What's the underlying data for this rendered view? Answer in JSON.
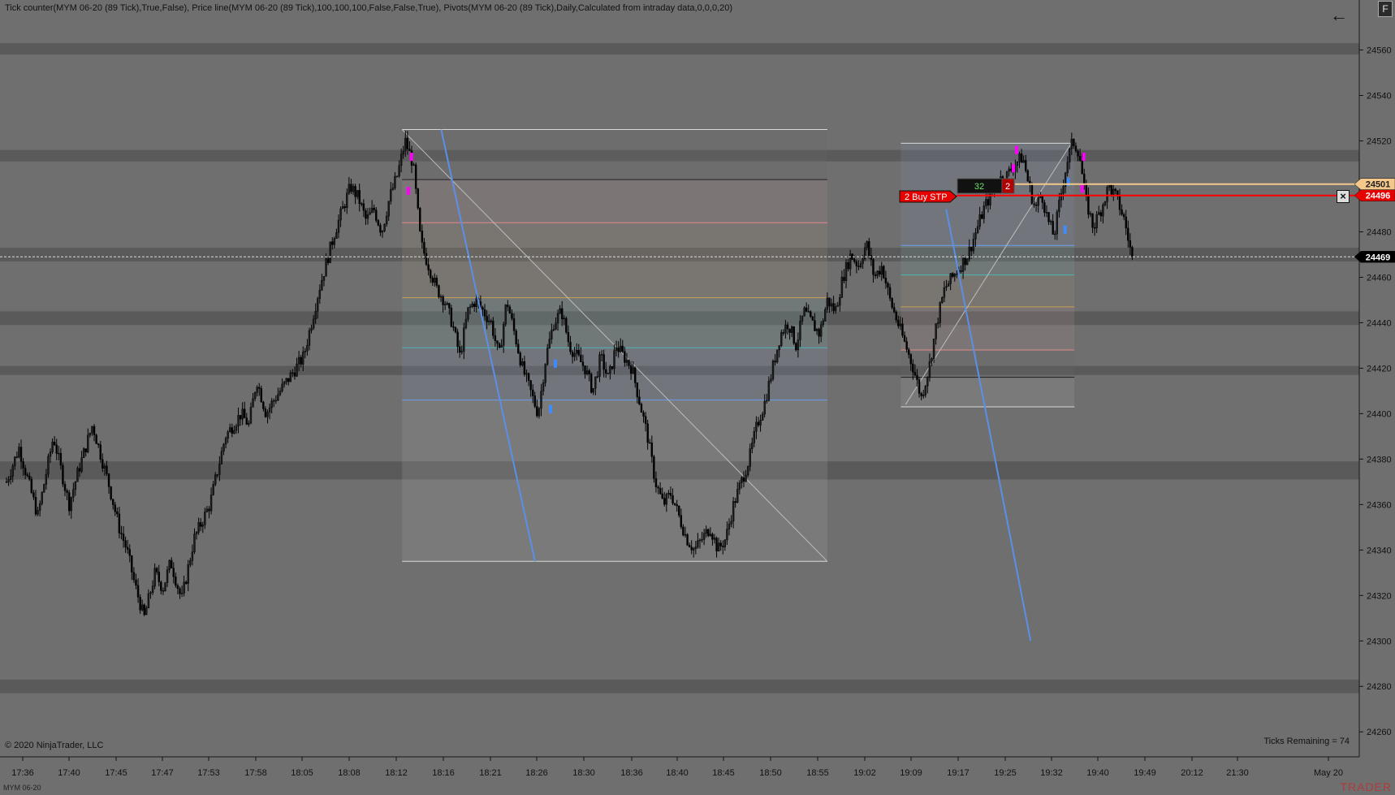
{
  "header": {
    "indicators_caption": "Tick counter(MYM 06-20 (89 Tick),True,False), Price line(MYM 06-20 (89 Tick),100,100,100,False,False,True), Pivots(MYM 06-20 (89 Tick),Daily,Calculated from intraday data,0,0,0,20)",
    "back_icon": "arrow-left-icon",
    "f_button_label": "F"
  },
  "footer": {
    "copyright": "© 2020 NinjaTrader, LLC",
    "ticks_remaining": "Ticks Remaining = 74",
    "instrument": "MYM 06-20",
    "brand": "TRADER"
  },
  "order": {
    "label": "2  Buy STP",
    "pnl_value": "32",
    "quantity": "2",
    "price": "24496",
    "close_icon": "close-x-icon"
  },
  "price_markers": {
    "ask": "24501",
    "last": "24469"
  },
  "colors": {
    "background": "#6f6f6f",
    "band": "#5a5a5a",
    "order_line": "#ff0000",
    "ask_line": "#f4c78a",
    "last_line": "#dddddd",
    "trend_line": "#5b8fe8",
    "marker_magenta": "#ff00ff",
    "marker_blue": "#3f8cff"
  },
  "chart_data": {
    "type": "candlestick",
    "title": "",
    "xlabel": "",
    "ylabel": "",
    "ylim": [
      24249,
      24582
    ],
    "y_ticks": [
      24560,
      24540,
      24520,
      24500,
      24480,
      24460,
      24440,
      24420,
      24400,
      24380,
      24360,
      24340,
      24320,
      24300,
      24280,
      24260
    ],
    "x_ticks": [
      "17:36",
      "17:40",
      "17:45",
      "17:47",
      "17:53",
      "17:58",
      "18:05",
      "18:08",
      "18:12",
      "18:16",
      "18:21",
      "18:26",
      "18:30",
      "18:36",
      "18:40",
      "18:45",
      "18:50",
      "18:55",
      "19:02",
      "19:09",
      "19:17",
      "19:25",
      "19:32",
      "19:40",
      "19:49",
      "20:12",
      "21:30",
      "May 20"
    ],
    "bands": [
      [
        24563,
        24558
      ],
      [
        24516,
        24511
      ],
      [
        24473,
        24467
      ],
      [
        24445,
        24439
      ],
      [
        24421,
        24417
      ],
      [
        24379,
        24371
      ],
      [
        24283,
        24277
      ]
    ],
    "path_anchors": [
      [
        0,
        24370
      ],
      [
        0.8,
        24385
      ],
      [
        2.0,
        24355
      ],
      [
        3.0,
        24390
      ],
      [
        4.0,
        24360
      ],
      [
        4.6,
        24375
      ],
      [
        5.5,
        24395
      ],
      [
        6.5,
        24370
      ],
      [
        7.2,
        24350
      ],
      [
        7.7,
        24340
      ],
      [
        8.2,
        24325
      ],
      [
        8.8,
        24310
      ],
      [
        9.5,
        24330
      ],
      [
        10.0,
        24323
      ],
      [
        10.5,
        24335
      ],
      [
        11.2,
        24318
      ],
      [
        12.0,
        24345
      ],
      [
        13.0,
        24360
      ],
      [
        14.0,
        24390
      ],
      [
        15.0,
        24400
      ],
      [
        15.5,
        24395
      ],
      [
        16.0,
        24415
      ],
      [
        16.6,
        24400
      ],
      [
        17.0,
        24405
      ],
      [
        18.0,
        24415
      ],
      [
        19.0,
        24425
      ],
      [
        19.5,
        24440
      ],
      [
        20.0,
        24455
      ],
      [
        21.0,
        24480
      ],
      [
        22.0,
        24500
      ],
      [
        22.5,
        24495
      ],
      [
        23.0,
        24485
      ],
      [
        23.5,
        24490
      ],
      [
        24.0,
        24480
      ],
      [
        24.5,
        24495
      ],
      [
        25.0,
        24505
      ],
      [
        25.5,
        24520
      ],
      [
        26.0,
        24510
      ],
      [
        26.5,
        24475
      ],
      [
        27.0,
        24465
      ],
      [
        27.5,
        24455
      ],
      [
        28.0,
        24450
      ],
      [
        28.5,
        24440
      ],
      [
        29.0,
        24425
      ],
      [
        29.5,
        24445
      ],
      [
        30.0,
        24450
      ],
      [
        31.0,
        24440
      ],
      [
        31.5,
        24425
      ],
      [
        32.0,
        24450
      ],
      [
        32.5,
        24435
      ],
      [
        33.0,
        24420
      ],
      [
        33.5,
        24410
      ],
      [
        34.0,
        24400
      ],
      [
        34.5,
        24425
      ],
      [
        35.0,
        24440
      ],
      [
        35.5,
        24445
      ],
      [
        36.0,
        24430
      ],
      [
        37.0,
        24420
      ],
      [
        37.5,
        24410
      ],
      [
        38.0,
        24425
      ],
      [
        38.5,
        24415
      ],
      [
        39.0,
        24430
      ],
      [
        40.0,
        24420
      ],
      [
        40.5,
        24405
      ],
      [
        41.0,
        24390
      ],
      [
        41.5,
        24370
      ],
      [
        42.0,
        24360
      ],
      [
        42.5,
        24365
      ],
      [
        43.0,
        24355
      ],
      [
        43.5,
        24345
      ],
      [
        44.0,
        24340
      ],
      [
        45.0,
        24350
      ],
      [
        45.5,
        24340
      ],
      [
        46.0,
        24345
      ],
      [
        46.5,
        24360
      ],
      [
        47.0,
        24370
      ],
      [
        47.5,
        24380
      ],
      [
        48.0,
        24395
      ],
      [
        48.5,
        24405
      ],
      [
        49.0,
        24420
      ],
      [
        49.5,
        24435
      ],
      [
        50.0,
        24440
      ],
      [
        50.5,
        24430
      ],
      [
        51.0,
        24445
      ],
      [
        51.5,
        24440
      ],
      [
        52.0,
        24435
      ],
      [
        52.5,
        24450
      ],
      [
        53.0,
        24445
      ],
      [
        53.5,
        24460
      ],
      [
        54.0,
        24470
      ],
      [
        54.5,
        24465
      ],
      [
        55.0,
        24475
      ],
      [
        55.5,
        24460
      ],
      [
        56.0,
        24465
      ],
      [
        56.5,
        24450
      ],
      [
        57.0,
        24440
      ],
      [
        57.5,
        24430
      ],
      [
        58.0,
        24420
      ],
      [
        58.5,
        24407
      ],
      [
        59.0,
        24420
      ],
      [
        59.5,
        24440
      ],
      [
        60.0,
        24455
      ],
      [
        60.5,
        24460
      ],
      [
        61.0,
        24465
      ],
      [
        61.5,
        24470
      ],
      [
        62.0,
        24480
      ],
      [
        62.5,
        24490
      ],
      [
        63.0,
        24497
      ],
      [
        63.5,
        24503
      ],
      [
        64.0,
        24505
      ],
      [
        64.5,
        24510
      ],
      [
        65.0,
        24513
      ],
      [
        65.4,
        24500
      ],
      [
        65.8,
        24490
      ],
      [
        66.2,
        24497
      ],
      [
        66.6,
        24485
      ],
      [
        67.0,
        24478
      ],
      [
        67.4,
        24495
      ],
      [
        67.8,
        24510
      ],
      [
        68.2,
        24520
      ],
      [
        68.6,
        24515
      ],
      [
        69.0,
        24495
      ],
      [
        69.5,
        24482
      ],
      [
        70.0,
        24490
      ],
      [
        70.5,
        24500
      ],
      [
        71.0,
        24495
      ],
      [
        71.5,
        24485
      ],
      [
        72.0,
        24468
      ]
    ],
    "candle_count": 540,
    "fib_left": {
      "x_range": [
        25.3,
        52.5
      ],
      "levels": [
        {
          "y": 24525,
          "color": "#d8d8d8"
        },
        {
          "y": 24503,
          "color": "#202020"
        },
        {
          "y": 24484,
          "color": "#e08a8a"
        },
        {
          "y": 24451,
          "color": "#c8a050"
        },
        {
          "y": 24429,
          "color": "#4fb3b3"
        },
        {
          "y": 24406,
          "color": "#6a9cf0"
        },
        {
          "y": 24335,
          "color": "#d8d8d8"
        }
      ],
      "diagonal": [
        [
          25.3,
          24525
        ],
        [
          52.5,
          24335
        ]
      ]
    },
    "fib_right": {
      "x_range": [
        57.2,
        68.3
      ],
      "levels": [
        {
          "y": 24519,
          "color": "#d8d8d8"
        },
        {
          "y": 24474,
          "color": "#6a9cf0"
        },
        {
          "y": 24461,
          "color": "#4fb3b3"
        },
        {
          "y": 24447,
          "color": "#c8a050"
        },
        {
          "y": 24428,
          "color": "#e08a8a"
        },
        {
          "y": 24416,
          "color": "#202020"
        },
        {
          "y": 24403,
          "color": "#d8d8d8"
        }
      ],
      "diagonal": [
        [
          57.5,
          24404
        ],
        [
          68.2,
          24520
        ]
      ]
    },
    "trend_lines": [
      {
        "from": [
          27.8,
          24525
        ],
        "to": [
          33.8,
          24335
        ]
      },
      {
        "from": [
          60.1,
          24490
        ],
        "to": [
          65.5,
          24300
        ]
      }
    ],
    "markers": [
      {
        "x": 25.9,
        "y": 24513,
        "color": "#ff00ff"
      },
      {
        "x": 25.7,
        "y": 24498,
        "color": "#ff00ff"
      },
      {
        "x": 35.1,
        "y": 24422,
        "color": "#3f8cff"
      },
      {
        "x": 34.8,
        "y": 24402,
        "color": "#3f8cff"
      },
      {
        "x": 64.6,
        "y": 24516,
        "color": "#ff00ff"
      },
      {
        "x": 64.4,
        "y": 24508,
        "color": "#ff00ff"
      },
      {
        "x": 68.9,
        "y": 24513,
        "color": "#ff00ff"
      },
      {
        "x": 67.9,
        "y": 24502,
        "color": "#3f8cff"
      },
      {
        "x": 67.7,
        "y": 24481,
        "color": "#3f8cff"
      },
      {
        "x": 68.8,
        "y": 24499,
        "color": "#ff00ff"
      }
    ],
    "x_domain": [
      0,
      86
    ]
  }
}
